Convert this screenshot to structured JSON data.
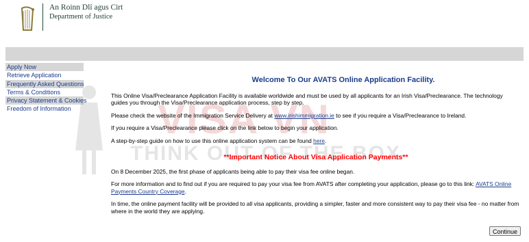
{
  "header": {
    "dept_irish": "An Roinn Dlí agus Cirt",
    "dept_english": "Department of Justice",
    "logo_icon": "harp-icon"
  },
  "sidebar": {
    "items": [
      {
        "label": "Apply Now",
        "shaded": true
      },
      {
        "label": "Retrieve Application",
        "shaded": false
      },
      {
        "label": "Frequently Asked Questions",
        "shaded": true
      },
      {
        "label": "Terms & Conditions",
        "shaded": false
      },
      {
        "label": "Privacy Statement & Cookies",
        "shaded": true
      },
      {
        "label": "Freedom of Information",
        "shaded": false
      }
    ]
  },
  "watermark": {
    "big": "VISA VN",
    "small": "THINK OUT OF THE BOX"
  },
  "main": {
    "title": "Welcome To Our AVATS Online Application Facility.",
    "p1": "This Online Visa/Preclearance Application Facility is available worldwide and must be used by all applicants for an Irish Visa/Preclearance. The technology guides you through the Visa/Preclearance application process, step by step.",
    "p2_before": "Please check the website of the Immigration Service Delivery at ",
    "p2_link": "www.irishimmigration.ie",
    "p2_after": " to see if you require a Visa/Preclearance to Ireland.",
    "p3": "If you require a Visa/Preclearance please click on the link below to begin your application.",
    "p4_before": "A step-by-step guide on how to use this online application system can be found ",
    "p4_link": "here",
    "p4_after": ".",
    "notice": "**Important Notice About Visa Application Payments**",
    "p5": "On 8 December 2025, the first phase of applicants being able to pay their visa fee online began.",
    "p6_before": "For more information and to find out if you are required to pay your visa fee from AVATS after completing your application, please go to this link: ",
    "p6_link": "AVATS Online Payments Country Coverage",
    "p6_after": ".",
    "p7": "In time, the online payment facility will be provided to all visa applicants, providing a simpler, faster and more consistent way to pay their visa fee - no matter from where in the world they are applying."
  },
  "continue_label": "Continue",
  "colors": {
    "link": "#1b3b8c",
    "notice": "#ff0000",
    "bar": "#d6d6d6"
  }
}
